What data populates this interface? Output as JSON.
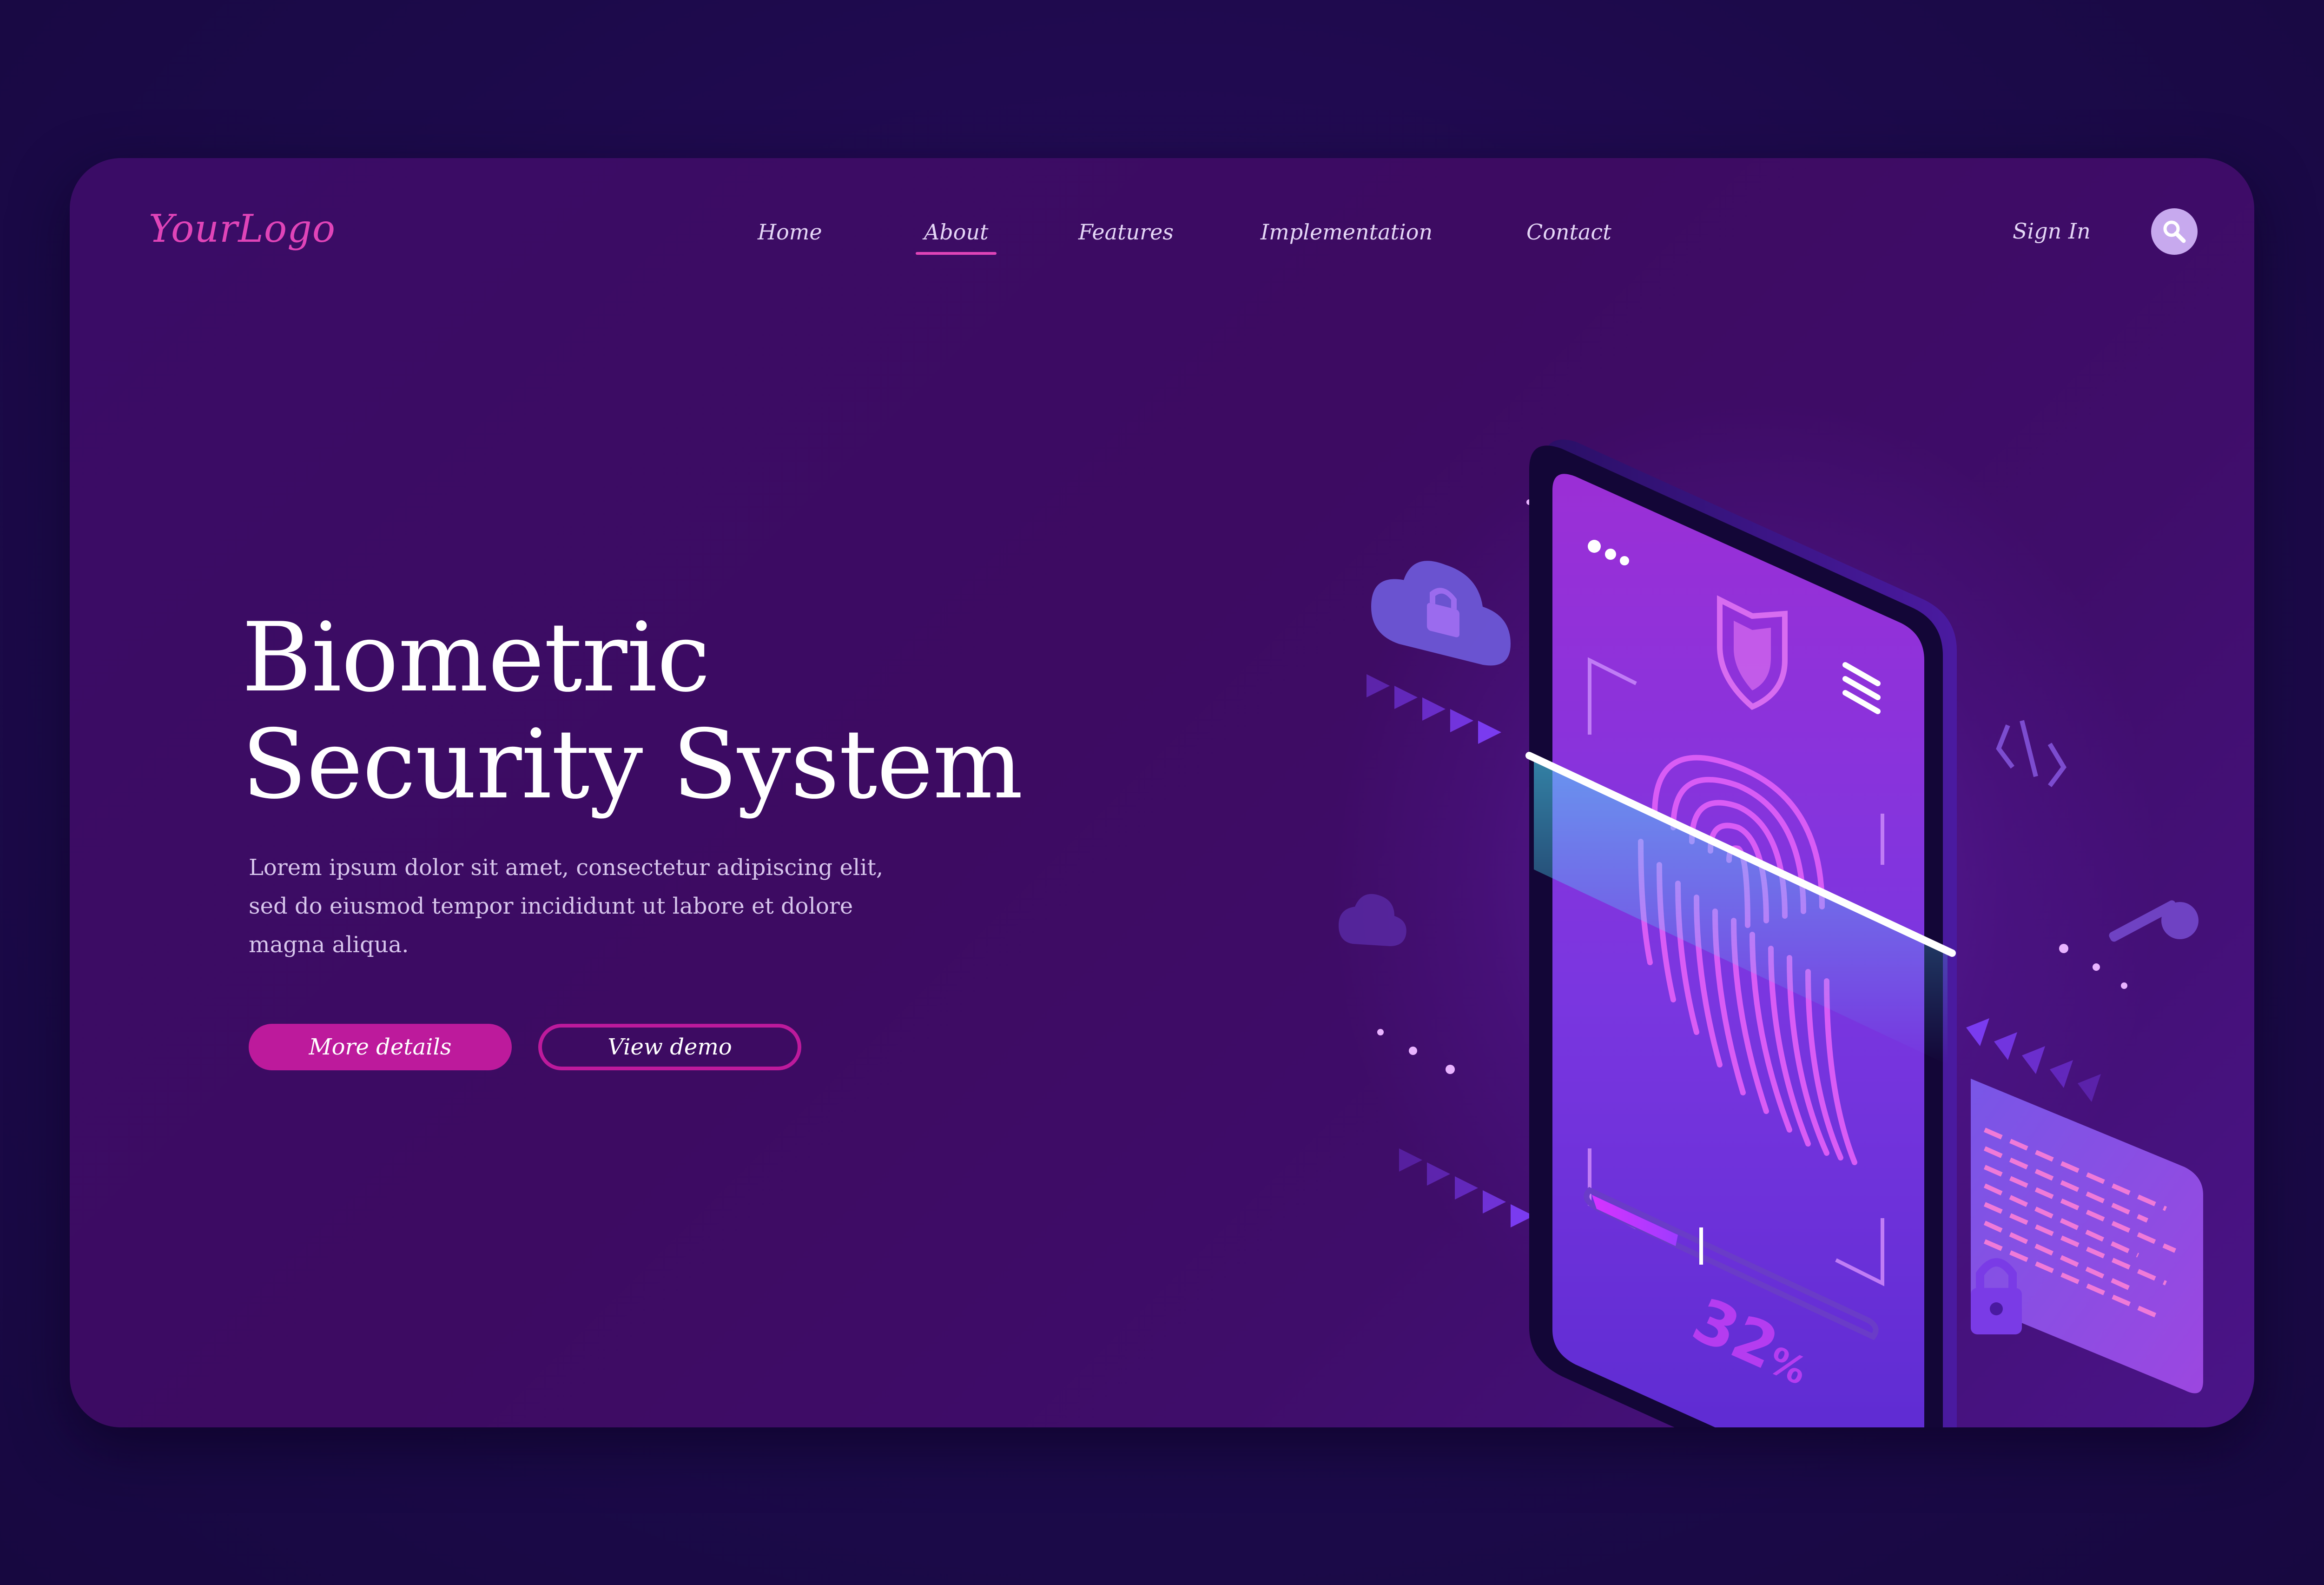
{
  "brand": {
    "logo_text": "YourLogo"
  },
  "nav": {
    "items": [
      {
        "label": "Home",
        "active": false
      },
      {
        "label": "About",
        "active": true
      },
      {
        "label": "Features",
        "active": false
      },
      {
        "label": "Implementation",
        "active": false
      },
      {
        "label": "Contact",
        "active": false
      }
    ],
    "sign_in": "Sign In",
    "search_icon": "search-icon"
  },
  "hero": {
    "title_line1": "Biometric",
    "title_line2": "Security System",
    "description_line1": "Lorem ipsum dolor sit amet, consectetur adipiscing elit,",
    "description_line2": "sed do eiusmod tempor incididunt ut labore et dolore",
    "description_line3": "magna aliqua.",
    "primary_button": "More details",
    "secondary_button": "View demo"
  },
  "illustration": {
    "scan_progress_text": "32",
    "scan_progress_unit": "%",
    "scan_progress_value": 0.32,
    "icons": [
      "cloud-lock-icon",
      "shield-icon",
      "menu-icon",
      "fingerprint-icon",
      "padlock-icon",
      "key-icon",
      "code-icon",
      "cloud-icon"
    ]
  },
  "colors": {
    "background": "#1c0a4a",
    "card": "#3d0b62",
    "accent": "#bd1a9c",
    "logo": "#e044b8",
    "text": "#ffffff",
    "muted_text": "#d7c5ec"
  }
}
